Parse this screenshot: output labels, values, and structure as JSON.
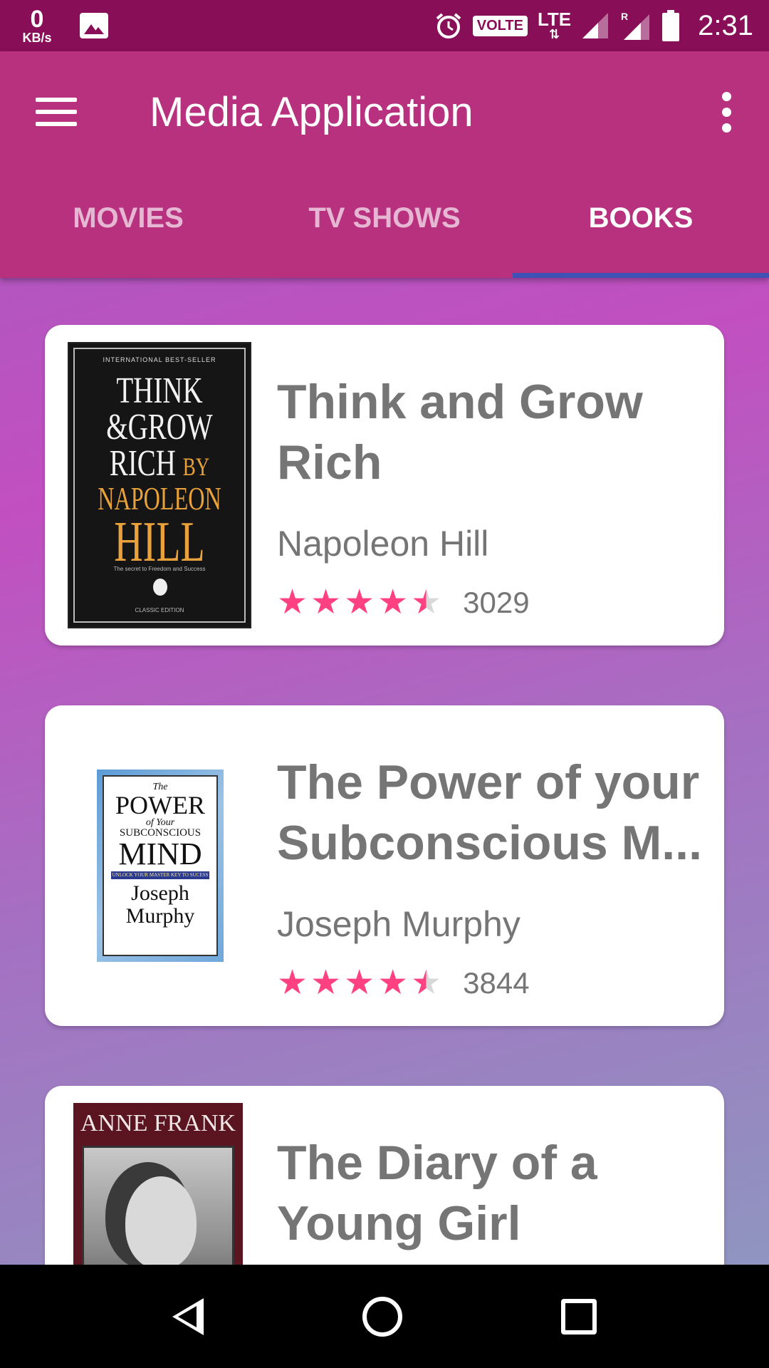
{
  "status_bar": {
    "net_speed": "0",
    "net_unit": "KB/s",
    "volte": "VOLTE",
    "lte": "LTE",
    "roaming": "R",
    "time": "2:31"
  },
  "app_bar": {
    "title": "Media Application"
  },
  "tabs": [
    {
      "label": "MOVIES",
      "active": false
    },
    {
      "label": "TV SHOWS",
      "active": false
    },
    {
      "label": "BOOKS",
      "active": true
    }
  ],
  "books": [
    {
      "title": "Think and Grow Rich",
      "author": "Napoleon Hill",
      "rating": 4.5,
      "count": "3029",
      "cover": {
        "top": "INTERNATIONAL BEST-SELLER",
        "line1": "THINK",
        "line2": "&GROW",
        "line3": "RICH",
        "line4": "BY",
        "line5": "NAPOLEON",
        "line6": "HILL",
        "sub": "The secret to Freedom and Success",
        "edition": "CLASSIC EDITION"
      }
    },
    {
      "title": "The Power of your Subconscious M...",
      "author": "Joseph Murphy",
      "rating": 4.5,
      "count": "3844",
      "cover": {
        "the": "The",
        "power": "POWER",
        "of": "of Your",
        "sub": "SUBCONSCIOUS",
        "mind": "MIND",
        "band": "UNLOCK YOUR MASTER KEY TO SUCESS",
        "au1": "Joseph",
        "au2": "Murphy"
      }
    },
    {
      "title": "The Diary of a Young Girl",
      "cover": {
        "name": "ANNE FRANK"
      }
    }
  ],
  "colors": {
    "status_bar": "#880E58",
    "app_bar": "#B8317F",
    "tab_indicator": "#3F51B5",
    "star": "#FF4081"
  }
}
